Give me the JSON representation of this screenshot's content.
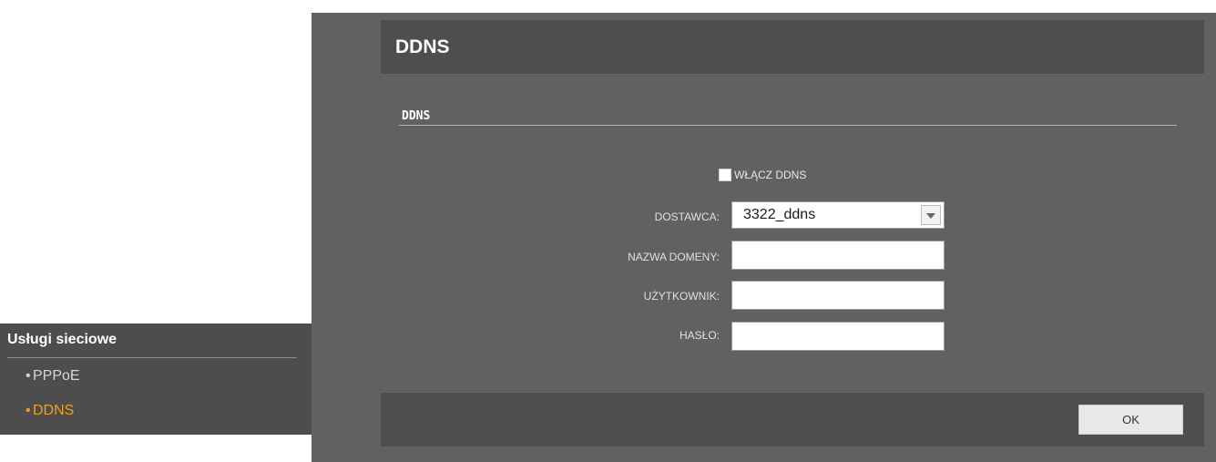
{
  "sidebar": {
    "title": "Usługi sieciowe",
    "items": [
      {
        "label": "PPPoE",
        "active": false
      },
      {
        "label": "DDNS",
        "active": true
      }
    ],
    "bullet": "•",
    "active_color": "#f0a020"
  },
  "header": {
    "title": "DDNS"
  },
  "section": {
    "title": "DDNS"
  },
  "form": {
    "enable_label": "WŁĄCZ DDNS",
    "enable_checked": false,
    "provider_label": "DOSTAWCA:",
    "provider_value": "3322_ddns",
    "domain_label": "NAZWA DOMENY:",
    "domain_value": "",
    "user_label": "UŻYTKOWNIK:",
    "user_value": "",
    "password_label": "HASŁO:",
    "password_value": ""
  },
  "footer": {
    "ok_label": "OK"
  },
  "icons": {
    "dropdown": "chevron-down-icon"
  },
  "colors": {
    "panel_bg": "#616161",
    "bar_bg": "#4e4e4e",
    "sidebar_bg": "#4d4d4d"
  }
}
